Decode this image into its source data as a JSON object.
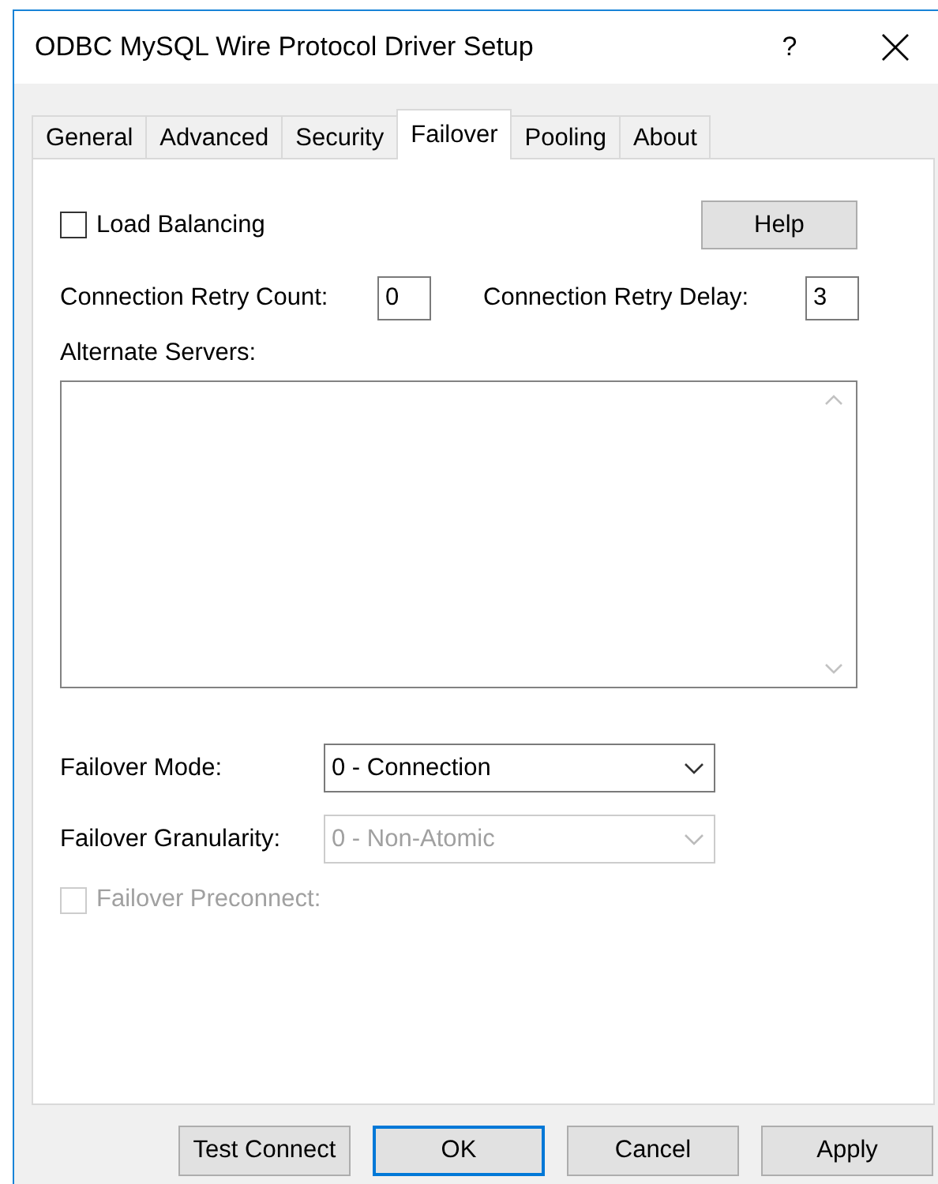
{
  "window": {
    "title": "ODBC MySQL Wire Protocol Driver Setup",
    "help_glyph": "?"
  },
  "tabs": [
    {
      "label": "General",
      "selected": false
    },
    {
      "label": "Advanced",
      "selected": false
    },
    {
      "label": "Security",
      "selected": false
    },
    {
      "label": "Failover",
      "selected": true
    },
    {
      "label": "Pooling",
      "selected": false
    },
    {
      "label": "About",
      "selected": false
    }
  ],
  "load_balancing": {
    "label": "Load Balancing",
    "checked": false,
    "disabled": false
  },
  "help_button": "Help",
  "retry_count": {
    "label": "Connection Retry Count:",
    "value": "0"
  },
  "retry_delay": {
    "label": "Connection Retry Delay:",
    "value": "3"
  },
  "alternate_servers": {
    "label": "Alternate Servers:"
  },
  "failover_mode": {
    "label": "Failover Mode:",
    "value": "0 - Connection",
    "disabled": false
  },
  "failover_granularity": {
    "label": "Failover Granularity:",
    "value": "0 - Non-Atomic",
    "disabled": true
  },
  "failover_preconnect": {
    "label": "Failover Preconnect:",
    "checked": false,
    "disabled": true
  },
  "buttons": [
    {
      "label": "Test Connect",
      "default": false
    },
    {
      "label": "OK",
      "default": true
    },
    {
      "label": "Cancel",
      "default": false
    },
    {
      "label": "Apply",
      "default": false
    }
  ]
}
